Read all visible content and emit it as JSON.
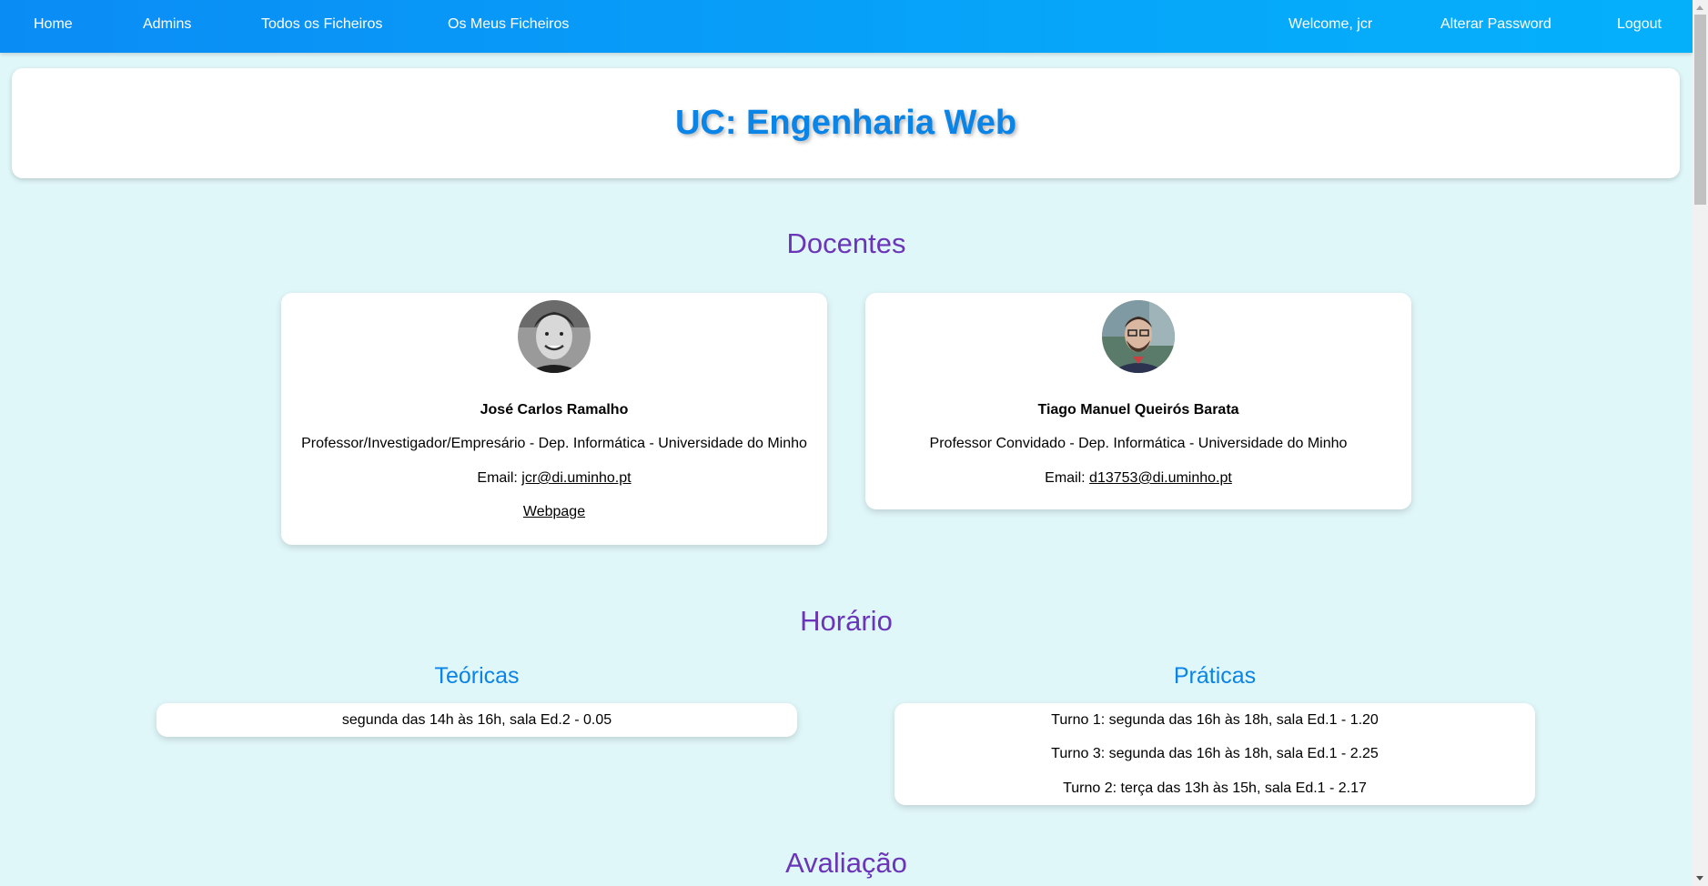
{
  "nav": {
    "home": "Home",
    "admins": "Admins",
    "todos_ficheiros": "Todos os Ficheiros",
    "meus_ficheiros": "Os Meus Ficheiros",
    "welcome": "Welcome, jcr",
    "alterar_password": "Alterar Password",
    "logout": "Logout"
  },
  "page_title": "UC: Engenharia Web",
  "sections": {
    "docentes": "Docentes",
    "horario": "Horário",
    "avaliacao": "Avaliação"
  },
  "docentes": [
    {
      "name": "José Carlos Ramalho",
      "role": "Professor/Investigador/Empresário - Dep. Informática - Universidade do Minho",
      "email_label": "Email:",
      "email": "jcr@di.uminho.pt",
      "webpage": "Webpage"
    },
    {
      "name": "Tiago Manuel Queirós Barata",
      "role": "Professor Convidado - Dep. Informática - Universidade do Minho",
      "email_label": "Email:",
      "email": "d13753@di.uminho.pt"
    }
  ],
  "horario": {
    "teoricas_title": "Teóricas",
    "teoricas": [
      "segunda das 14h às 16h, sala Ed.2 - 0.05"
    ],
    "praticas_title": "Práticas",
    "praticas": [
      "Turno 1: segunda das 16h às 18h, sala Ed.1 - 1.20",
      "Turno 3: segunda das 16h às 18h, sala Ed.1 - 2.25",
      "Turno 2: terça das 13h às 15h, sala Ed.1 - 2.17"
    ]
  },
  "colors": {
    "navbar": "#0a8cf5",
    "title": "#0a84e6",
    "section_heading": "#6a35b8",
    "background": "#e0f7f9"
  }
}
